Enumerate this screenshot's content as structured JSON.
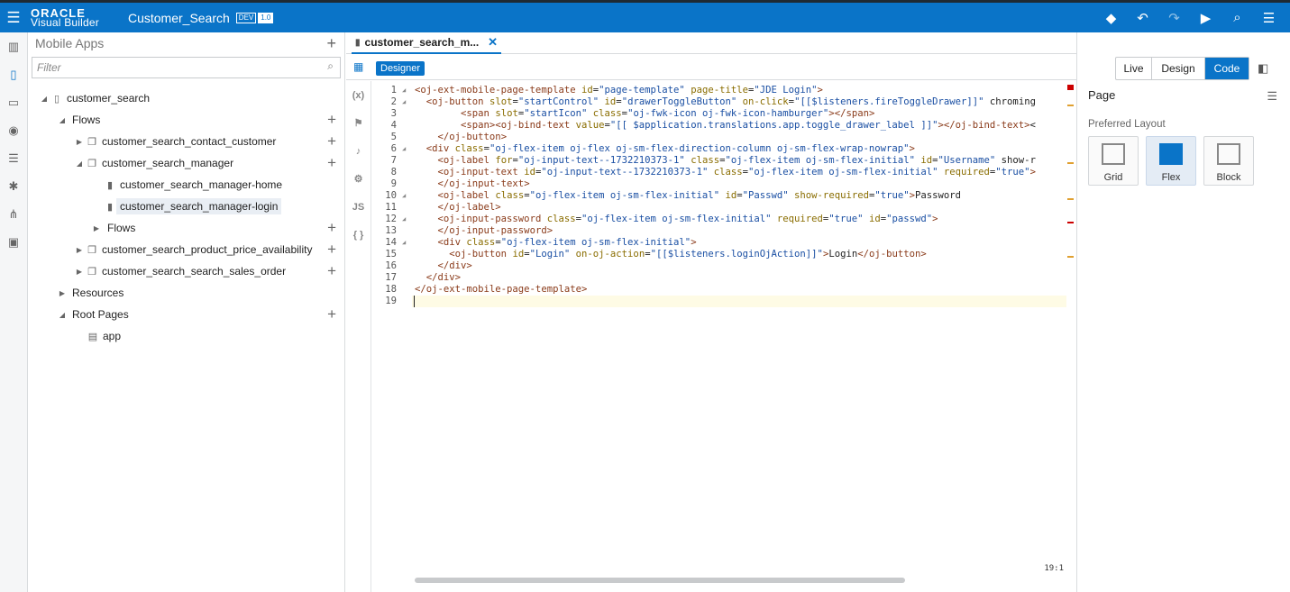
{
  "header": {
    "logo_top": "ORACLE",
    "logo_bottom": "Visual Builder",
    "app_title": "Customer_Search",
    "env_badge": "DEV",
    "version_badge": "1.0"
  },
  "navigator": {
    "title": "Mobile Apps",
    "filter_placeholder": "Filter",
    "tree": {
      "root": "customer_search",
      "flows": "Flows",
      "flow_contact": "customer_search_contact_customer",
      "flow_manager": "customer_search_manager",
      "page_home": "customer_search_manager-home",
      "page_login": "customer_search_manager-login",
      "sub_flows": "Flows",
      "flow_price": "customer_search_product_price_availability",
      "flow_sales": "customer_search_search_sales_order",
      "resources": "Resources",
      "root_pages": "Root Pages",
      "app": "app"
    }
  },
  "editor": {
    "tab_label": "customer_search_m...",
    "designer_label": "Designer",
    "side_js": "JS",
    "side_braces": "{ }",
    "side_var": "(x)",
    "cursor_pos": "19:1",
    "lines": [
      "<oj-ext-mobile-page-template id=\"page-template\" page-title=\"JDE Login\">",
      "  <oj-button slot=\"startControl\" id=\"drawerToggleButton\" on-click=\"[[$listeners.fireToggleDrawer]]\" chroming",
      "        <span slot=\"startIcon\" class=\"oj-fwk-icon oj-fwk-icon-hamburger\"></span>",
      "        <span><oj-bind-text value=\"[[ $application.translations.app.toggle_drawer_label ]]\"></oj-bind-text><",
      "    </oj-button>",
      "  <div class=\"oj-flex-item oj-flex oj-sm-flex-direction-column oj-sm-flex-wrap-nowrap\">",
      "    <oj-label for=\"oj-input-text--1732210373-1\" class=\"oj-flex-item oj-sm-flex-initial\" id=\"Username\" show-r",
      "    <oj-input-text id=\"oj-input-text--1732210373-1\" class=\"oj-flex-item oj-sm-flex-initial\" required=\"true\">",
      "    </oj-input-text>",
      "    <oj-label class=\"oj-flex-item oj-sm-flex-initial\" id=\"Passwd\" show-required=\"true\">Password",
      "    </oj-label>",
      "    <oj-input-password class=\"oj-flex-item oj-sm-flex-initial\" required=\"true\" id=\"passwd\">",
      "    </oj-input-password>",
      "    <div class=\"oj-flex-item oj-sm-flex-initial\">",
      "      <oj-button id=\"Login\" on-oj-action=\"[[$listeners.loginOjAction]]\">Login</oj-button>",
      "    </div>",
      "  </div>",
      "</oj-ext-mobile-page-template>",
      ""
    ]
  },
  "properties": {
    "mode_live": "Live",
    "mode_design": "Design",
    "mode_code": "Code",
    "title": "Page",
    "preferred_layout_label": "Preferred Layout",
    "layouts": [
      "Grid",
      "Flex",
      "Block"
    ],
    "selected_layout": "Flex"
  },
  "colors": {
    "accent": "#0a74c8",
    "tag": "#8a3b1a",
    "attr": "#8a6d00",
    "value": "#1a4fa3"
  }
}
